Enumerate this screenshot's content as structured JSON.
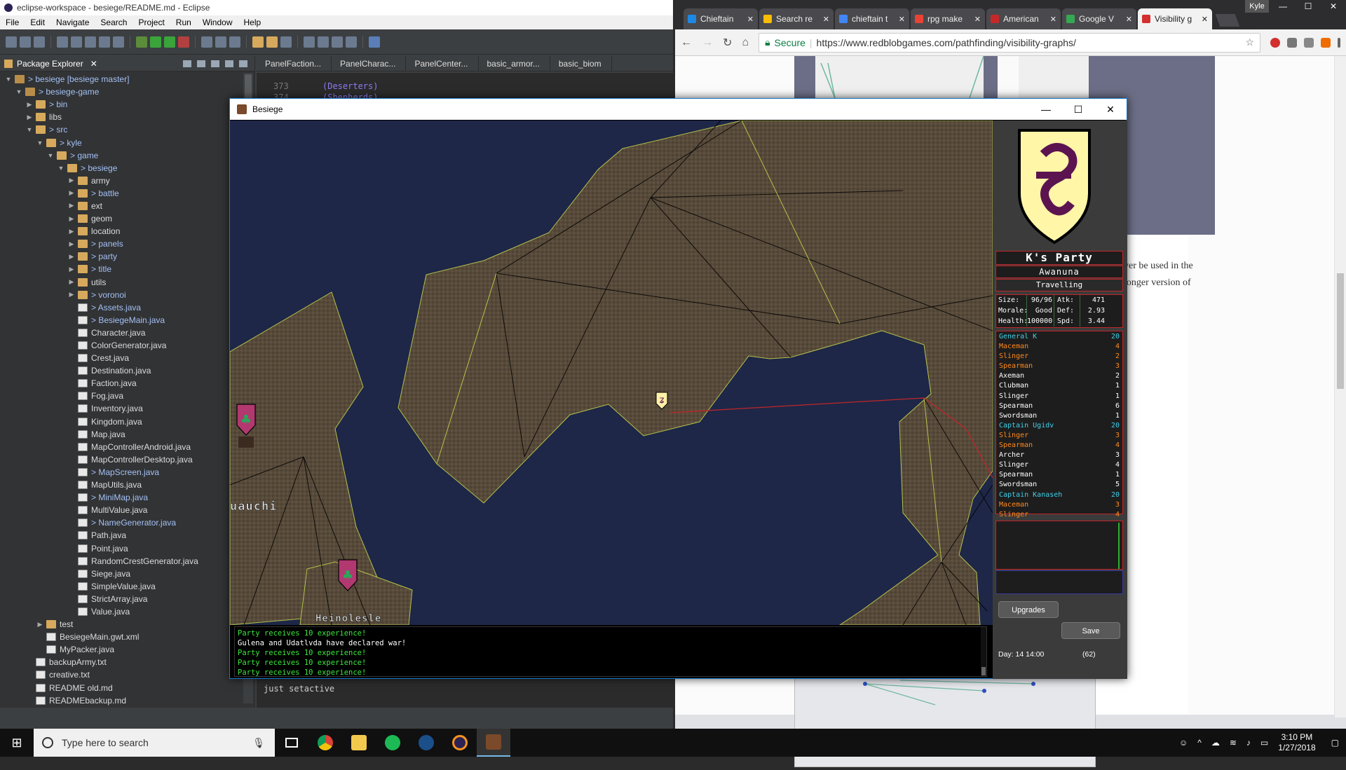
{
  "eclipse": {
    "title": "eclipse-workspace - besiege/README.md - Eclipse",
    "menu": [
      "File",
      "Edit",
      "Navigate",
      "Search",
      "Project",
      "Run",
      "Window",
      "Help"
    ],
    "package_explorer_tab": "Package Explorer",
    "tree": [
      {
        "label": "> besiege [besiege master]",
        "indent": 0,
        "icon": "proj",
        "twisty": "▼",
        "mod": true
      },
      {
        "label": "> besiege-game",
        "indent": 1,
        "icon": "proj",
        "twisty": "▼",
        "mod": true
      },
      {
        "label": "> bin",
        "indent": 2,
        "icon": "folder",
        "twisty": "▶",
        "mod": true
      },
      {
        "label": "libs",
        "indent": 2,
        "icon": "folder",
        "twisty": "▶",
        "mod": false
      },
      {
        "label": "> src",
        "indent": 2,
        "icon": "folder",
        "twisty": "▼",
        "mod": true
      },
      {
        "label": "> kyle",
        "indent": 3,
        "icon": "folder",
        "twisty": "▼",
        "mod": true
      },
      {
        "label": "> game",
        "indent": 4,
        "icon": "folder",
        "twisty": "▼",
        "mod": true
      },
      {
        "label": "> besiege",
        "indent": 5,
        "icon": "folder",
        "twisty": "▼",
        "mod": true
      },
      {
        "label": "army",
        "indent": 6,
        "icon": "folder",
        "twisty": "▶",
        "mod": false
      },
      {
        "label": "> battle",
        "indent": 6,
        "icon": "folder",
        "twisty": "▶",
        "mod": true
      },
      {
        "label": "ext",
        "indent": 6,
        "icon": "folder",
        "twisty": "▶",
        "mod": false
      },
      {
        "label": "geom",
        "indent": 6,
        "icon": "folder",
        "twisty": "▶",
        "mod": false
      },
      {
        "label": "location",
        "indent": 6,
        "icon": "folder",
        "twisty": "▶",
        "mod": false
      },
      {
        "label": "> panels",
        "indent": 6,
        "icon": "folder",
        "twisty": "▶",
        "mod": true
      },
      {
        "label": "> party",
        "indent": 6,
        "icon": "folder",
        "twisty": "▶",
        "mod": true
      },
      {
        "label": "> title",
        "indent": 6,
        "icon": "folder",
        "twisty": "▶",
        "mod": true
      },
      {
        "label": "utils",
        "indent": 6,
        "icon": "folder",
        "twisty": "▶",
        "mod": false
      },
      {
        "label": "> voronoi",
        "indent": 6,
        "icon": "folder",
        "twisty": "▶",
        "mod": true
      },
      {
        "label": "> Assets.java",
        "indent": 6,
        "icon": "file",
        "twisty": "",
        "mod": true
      },
      {
        "label": "> BesiegeMain.java",
        "indent": 6,
        "icon": "file",
        "twisty": "",
        "mod": true
      },
      {
        "label": "Character.java",
        "indent": 6,
        "icon": "file",
        "twisty": "",
        "mod": false
      },
      {
        "label": "ColorGenerator.java",
        "indent": 6,
        "icon": "file",
        "twisty": "",
        "mod": false
      },
      {
        "label": "Crest.java",
        "indent": 6,
        "icon": "file",
        "twisty": "",
        "mod": false
      },
      {
        "label": "Destination.java",
        "indent": 6,
        "icon": "file",
        "twisty": "",
        "mod": false
      },
      {
        "label": "Faction.java",
        "indent": 6,
        "icon": "file",
        "twisty": "",
        "mod": false
      },
      {
        "label": "Fog.java",
        "indent": 6,
        "icon": "file",
        "twisty": "",
        "mod": false
      },
      {
        "label": "Inventory.java",
        "indent": 6,
        "icon": "file",
        "twisty": "",
        "mod": false
      },
      {
        "label": "Kingdom.java",
        "indent": 6,
        "icon": "file",
        "twisty": "",
        "mod": false
      },
      {
        "label": "Map.java",
        "indent": 6,
        "icon": "file",
        "twisty": "",
        "mod": false
      },
      {
        "label": "MapControllerAndroid.java",
        "indent": 6,
        "icon": "file",
        "twisty": "",
        "mod": false
      },
      {
        "label": "MapControllerDesktop.java",
        "indent": 6,
        "icon": "file",
        "twisty": "",
        "mod": false
      },
      {
        "label": "> MapScreen.java",
        "indent": 6,
        "icon": "file",
        "twisty": "",
        "mod": true
      },
      {
        "label": "MapUtils.java",
        "indent": 6,
        "icon": "file",
        "twisty": "",
        "mod": false
      },
      {
        "label": "> MiniMap.java",
        "indent": 6,
        "icon": "file",
        "twisty": "",
        "mod": true
      },
      {
        "label": "MultiValue.java",
        "indent": 6,
        "icon": "file",
        "twisty": "",
        "mod": false
      },
      {
        "label": "> NameGenerator.java",
        "indent": 6,
        "icon": "file",
        "twisty": "",
        "mod": true
      },
      {
        "label": "Path.java",
        "indent": 6,
        "icon": "file",
        "twisty": "",
        "mod": false
      },
      {
        "label": "Point.java",
        "indent": 6,
        "icon": "file",
        "twisty": "",
        "mod": false
      },
      {
        "label": "RandomCrestGenerator.java",
        "indent": 6,
        "icon": "file",
        "twisty": "",
        "mod": false
      },
      {
        "label": "Siege.java",
        "indent": 6,
        "icon": "file",
        "twisty": "",
        "mod": false
      },
      {
        "label": "SimpleValue.java",
        "indent": 6,
        "icon": "file",
        "twisty": "",
        "mod": false
      },
      {
        "label": "StrictArray.java",
        "indent": 6,
        "icon": "file",
        "twisty": "",
        "mod": false
      },
      {
        "label": "Value.java",
        "indent": 6,
        "icon": "file",
        "twisty": "",
        "mod": false
      },
      {
        "label": "test",
        "indent": 3,
        "icon": "folder",
        "twisty": "▶",
        "mod": false
      },
      {
        "label": "BesiegeMain.gwt.xml",
        "indent": 3,
        "icon": "file",
        "twisty": "",
        "mod": false
      },
      {
        "label": "MyPacker.java",
        "indent": 3,
        "icon": "file",
        "twisty": "",
        "mod": false
      },
      {
        "label": "backupArmy.txt",
        "indent": 2,
        "icon": "file",
        "twisty": "",
        "mod": false
      },
      {
        "label": "creative.txt",
        "indent": 2,
        "icon": "file",
        "twisty": "",
        "mod": false
      },
      {
        "label": "README old.md",
        "indent": 2,
        "icon": "file",
        "twisty": "",
        "mod": false
      },
      {
        "label": "READMEbackup.md",
        "indent": 2,
        "icon": "file",
        "twisty": "",
        "mod": false
      }
    ],
    "editor_tabs": [
      "PanelFaction...",
      "PanelCharac...",
      "PanelCenter...",
      "basic_armor...",
      "basic_biom"
    ],
    "editor_lines": [
      {
        "num": "373",
        "code": "(Deserters)"
      },
      {
        "num": "374",
        "code": "(Shepherds)"
      }
    ],
    "editor_bottom_text": "just setactive"
  },
  "chrome": {
    "tabs": [
      {
        "label": "Chieftain",
        "color": "#1e88e5",
        "active": false
      },
      {
        "label": "Search re",
        "color": "#fbbc04",
        "active": false
      },
      {
        "label": "chieftain t",
        "color": "#4285f4",
        "active": false
      },
      {
        "label": "rpg make",
        "color": "#ea4335",
        "active": false
      },
      {
        "label": "American",
        "color": "#c62828",
        "active": false
      },
      {
        "label": "Google V",
        "color": "#34a853",
        "active": false
      },
      {
        "label": "Visibility g",
        "color": "#d32f2f",
        "active": true
      }
    ],
    "user": "Kyle",
    "secure_label": "Secure",
    "url": "https://www.redblobgames.com/pathfinding/visibility-graphs/",
    "page_text_1": "ver be used in the",
    "page_text_2": "longer version of"
  },
  "besiege": {
    "title": "Besiege",
    "party_name": "K's Party",
    "location": "Awanuna",
    "status": "Travelling",
    "stats": [
      {
        "k1": "Size:",
        "v1": "96/96",
        "k2": "Atk:",
        "v2": "471"
      },
      {
        "k1": "Morale:",
        "v1": "Good",
        "k2": "Def:",
        "v2": "2.93"
      },
      {
        "k1": "Health:",
        "v1": "100000",
        "k2": "Spd:",
        "v2": "3.44"
      }
    ],
    "troops": [
      {
        "name": "General K",
        "count": "20",
        "kind": "general"
      },
      {
        "name": "Maceman",
        "count": "4",
        "kind": "orange"
      },
      {
        "name": "Slinger",
        "count": "2",
        "kind": "orange"
      },
      {
        "name": "Spearman",
        "count": "3",
        "kind": "orange"
      },
      {
        "name": "Axeman",
        "count": "2",
        "kind": "white"
      },
      {
        "name": "Clubman",
        "count": "1",
        "kind": "white"
      },
      {
        "name": "Slinger",
        "count": "1",
        "kind": "white"
      },
      {
        "name": "Spearman",
        "count": "6",
        "kind": "white"
      },
      {
        "name": "Swordsman",
        "count": "1",
        "kind": "white"
      },
      {
        "name": "Captain Ugidv",
        "count": "20",
        "kind": "general"
      },
      {
        "name": "Slinger",
        "count": "3",
        "kind": "orange"
      },
      {
        "name": "Spearman",
        "count": "4",
        "kind": "orange"
      },
      {
        "name": "Archer",
        "count": "3",
        "kind": "white"
      },
      {
        "name": "Slinger",
        "count": "4",
        "kind": "white"
      },
      {
        "name": "Spearman",
        "count": "1",
        "kind": "white"
      },
      {
        "name": "Swordsman",
        "count": "5",
        "kind": "white"
      },
      {
        "name": "Captain Kanaseh",
        "count": "20",
        "kind": "general"
      },
      {
        "name": "Maceman",
        "count": "3",
        "kind": "orange"
      },
      {
        "name": "Slinger",
        "count": "4",
        "kind": "orange"
      }
    ],
    "upgrades_label": "Upgrades",
    "save_label": "Save",
    "day": "Day: 14 14:00",
    "day_count": "(62)",
    "city_labels": [
      "uauchi",
      "Heinolesle"
    ],
    "log": [
      {
        "text": "Party receives 10 experience!",
        "color": "#3be83b"
      },
      {
        "text": "Gulena and Udatlvda have declared war!",
        "color": "#ffffff"
      },
      {
        "text": "Party receives 10 experience!",
        "color": "#3be83b"
      },
      {
        "text": "Party receives 10 experience!",
        "color": "#3be83b"
      },
      {
        "text": "Party receives 10 experience!",
        "color": "#3be83b"
      }
    ]
  },
  "taskbar": {
    "search_placeholder": "Type here to search",
    "time": "3:10 PM",
    "date": "1/27/2018"
  }
}
